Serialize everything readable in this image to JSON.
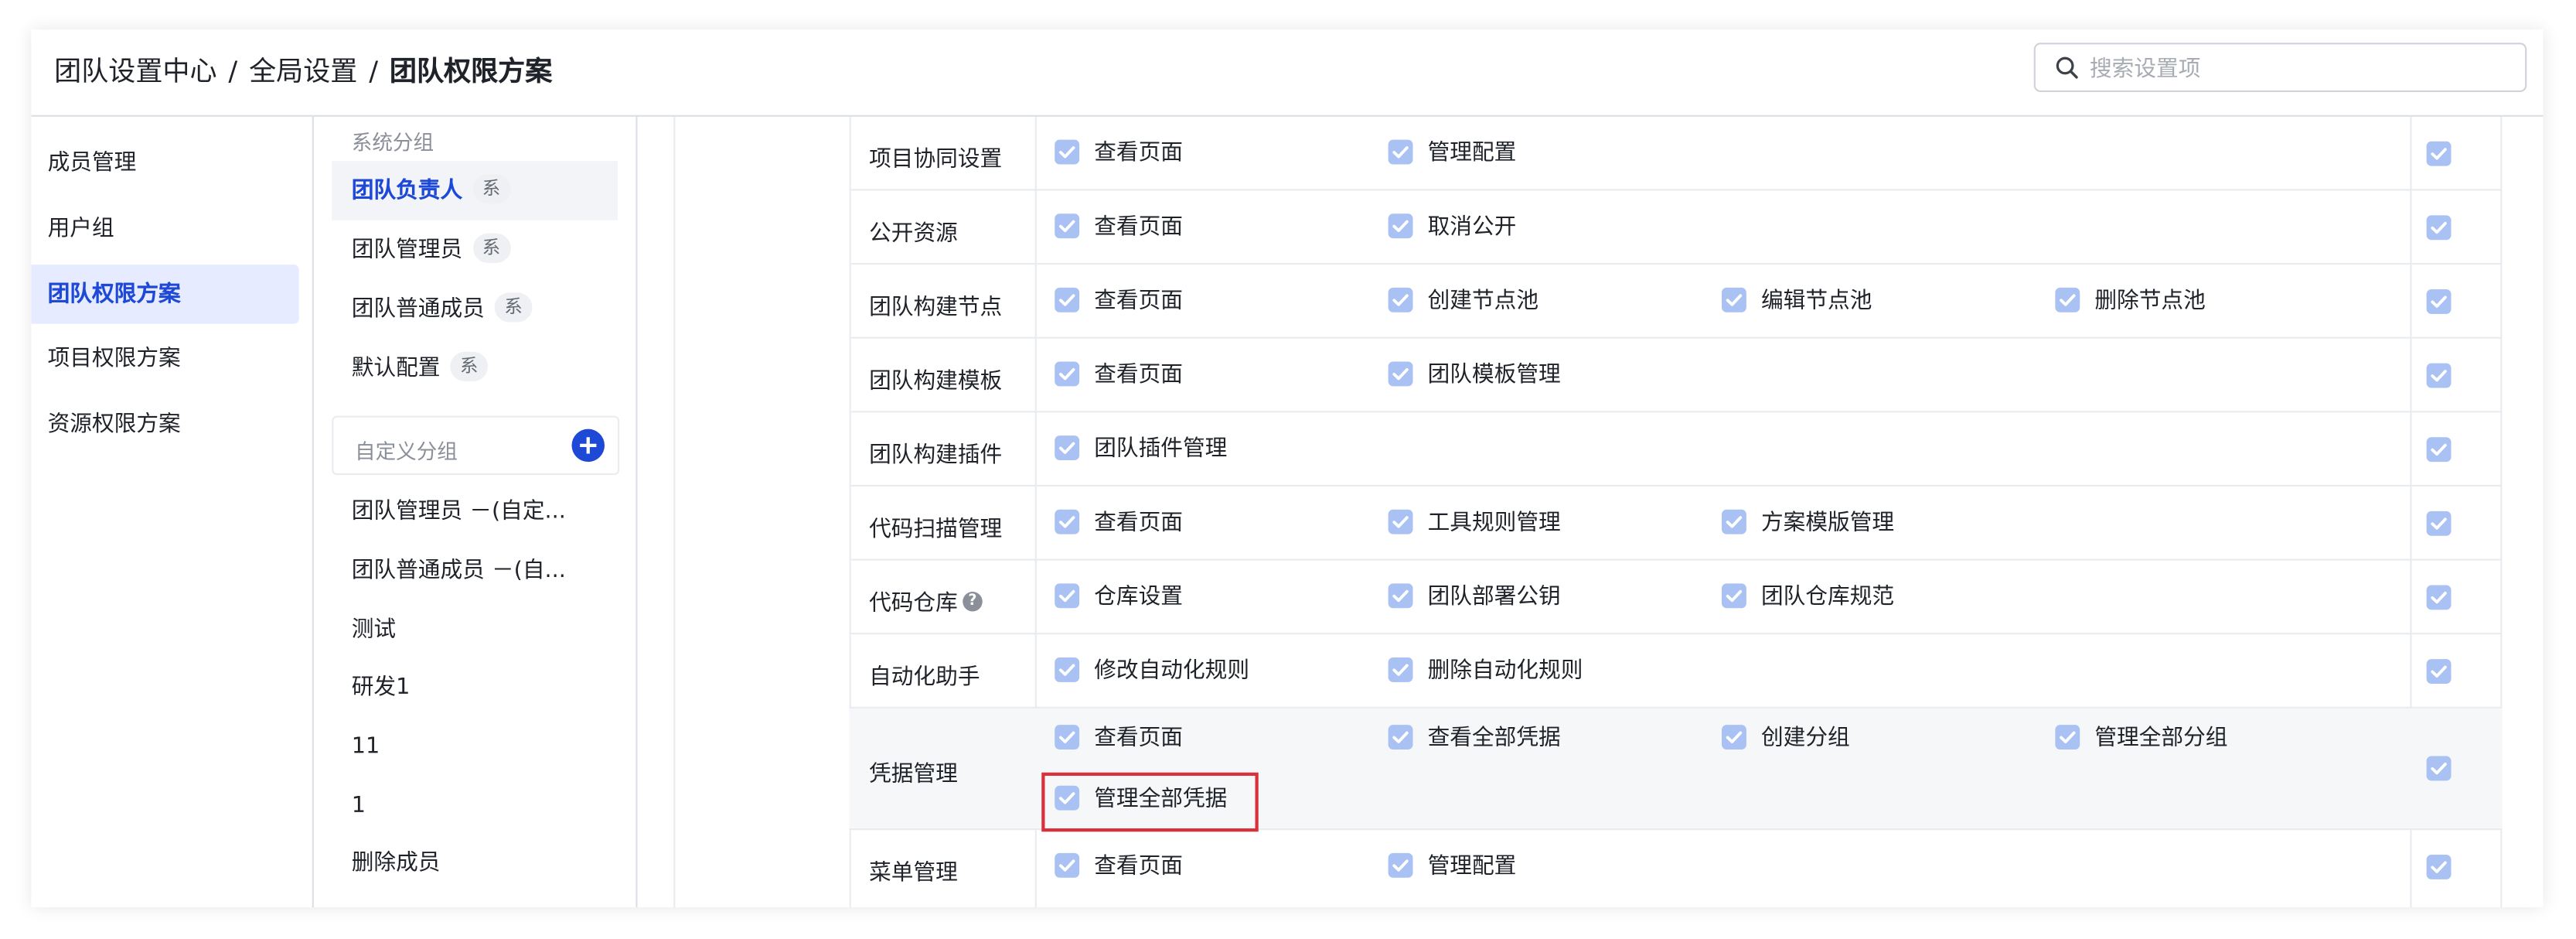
{
  "breadcrumb": {
    "items": [
      "团队设置中心",
      "全局设置",
      "团队权限方案"
    ],
    "separator": "/"
  },
  "search": {
    "placeholder": "搜索设置项"
  },
  "left_nav": {
    "items": [
      {
        "label": "成员管理"
      },
      {
        "label": "用户组"
      },
      {
        "label": "团队权限方案",
        "active": true
      },
      {
        "label": "项目权限方案"
      },
      {
        "label": "资源权限方案"
      }
    ]
  },
  "roles": {
    "system_group_label": "系统分组",
    "system_badge": "系",
    "system": [
      {
        "label": "团队负责人",
        "active": true
      },
      {
        "label": "团队管理员"
      },
      {
        "label": "团队普通成员"
      },
      {
        "label": "默认配置"
      }
    ],
    "custom_group_label": "自定义分组",
    "custom": [
      {
        "label": "团队管理员 －(自定..."
      },
      {
        "label": "团队普通成员 －(自..."
      },
      {
        "label": "测试"
      },
      {
        "label": "研发1"
      },
      {
        "label": "11"
      },
      {
        "label": "1"
      },
      {
        "label": "删除成员"
      }
    ]
  },
  "permissions": {
    "rows": [
      {
        "name": "项目协同设置",
        "perms": [
          "查看页面",
          "管理配置"
        ]
      },
      {
        "name": "公开资源",
        "perms": [
          "查看页面",
          "取消公开"
        ]
      },
      {
        "name": "团队构建节点",
        "perms": [
          "查看页面",
          "创建节点池",
          "编辑节点池",
          "删除节点池"
        ]
      },
      {
        "name": "团队构建模板",
        "perms": [
          "查看页面",
          "团队模板管理"
        ]
      },
      {
        "name": "团队构建插件",
        "perms": [
          "团队插件管理"
        ]
      },
      {
        "name": "代码扫描管理",
        "perms": [
          "查看页面",
          "工具规则管理",
          "方案模版管理"
        ]
      },
      {
        "name": "代码仓库",
        "perms": [
          "仓库设置",
          "团队部署公钥",
          "团队仓库规范"
        ]
      },
      {
        "name": "自动化助手",
        "perms": [
          "修改自动化规则",
          "删除自动化规则"
        ]
      },
      {
        "name": "凭据管理",
        "perms": [
          "查看页面",
          "查看全部凭据",
          "创建分组",
          "管理全部分组",
          "管理全部凭据"
        ]
      },
      {
        "name": "菜单管理",
        "perms": [
          "查看页面",
          "管理配置"
        ]
      }
    ]
  },
  "colors": {
    "accent": "#1e49d6",
    "checkbox": "#a9c1f3",
    "active_nav_bg": "#e6ebff",
    "highlight_border": "#d9303a"
  }
}
